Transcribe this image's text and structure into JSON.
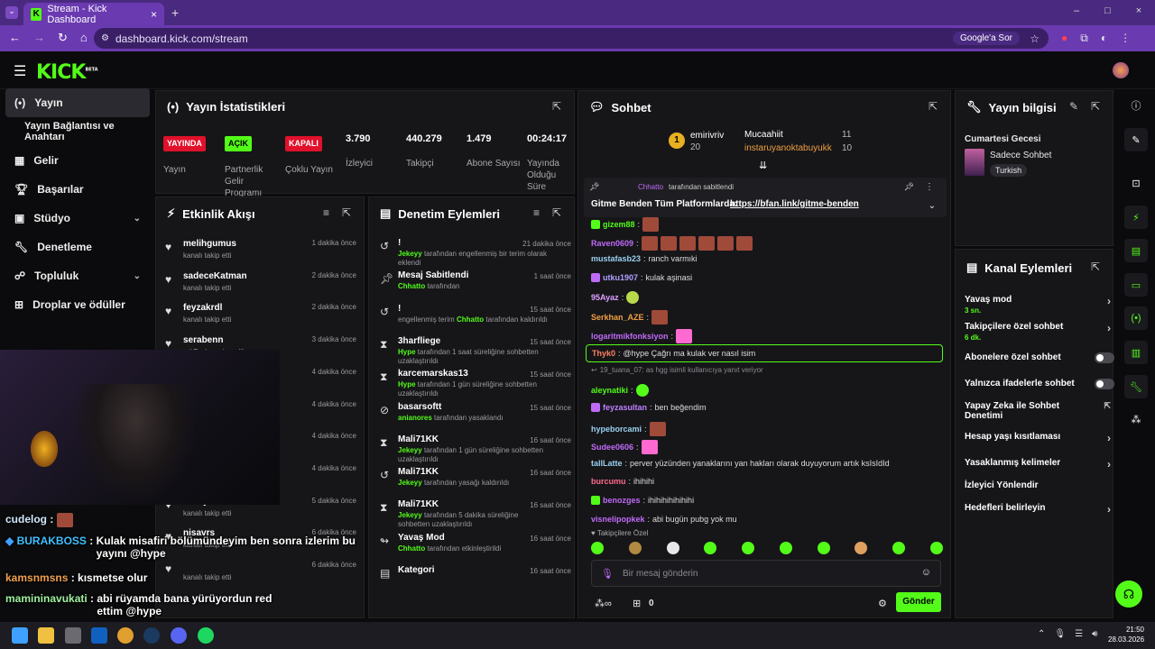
{
  "browser": {
    "tab_title": "Stream - Kick Dashboard",
    "url": "dashboard.kick.com/stream",
    "google_chip": "Google'a Sor"
  },
  "brand": {
    "logo": "KICK",
    "beta": "BETA"
  },
  "sidebar": {
    "items": [
      {
        "label": "Yayın",
        "icon": "broadcast-icon"
      },
      {
        "label": "Yayın Bağlantısı ve Anahtarı"
      },
      {
        "label": "Gelir",
        "icon": "revenue-icon"
      },
      {
        "label": "Başarılar",
        "icon": "trophy-icon"
      },
      {
        "label": "Stüdyo",
        "icon": "studio-icon"
      },
      {
        "label": "Denetleme",
        "icon": "wrench-icon"
      },
      {
        "label": "Topluluk",
        "icon": "community-icon"
      },
      {
        "label": "Droplar ve ödüller",
        "icon": "drops-icon"
      }
    ]
  },
  "stats": {
    "title": "Yayın İstatistikleri",
    "items": [
      {
        "badge": "YAYINDA",
        "label": "Yayın"
      },
      {
        "badge": "AÇIK",
        "label": "Partnerlik Gelir Programı"
      },
      {
        "badge": "KAPALI",
        "label": "Çoklu Yayın"
      },
      {
        "value": "3.790",
        "label": "İzleyici"
      },
      {
        "value": "440.279",
        "label": "Takipçi"
      },
      {
        "value": "1.479",
        "label": "Abone Sayısı"
      },
      {
        "value": "00:24:17",
        "label": "Yayında Olduğu Süre"
      }
    ]
  },
  "activity": {
    "title": "Etkinlik Akışı",
    "events": [
      {
        "name": "melihgumus",
        "desc": "kanalı takip etti",
        "time": "1 dakika önce"
      },
      {
        "name": "sadeceKatman",
        "desc": "kanalı takip etti",
        "time": "2 dakika önce"
      },
      {
        "name": "feyzakrdl",
        "desc": "kanalı takip etti",
        "time": "2 dakika önce"
      },
      {
        "name": "serabenn",
        "desc": "or! Toplam abonelik",
        "time": "3 dakika önce"
      },
      {
        "name": "",
        "desc": "",
        "time": "4 dakika önce"
      },
      {
        "name": "",
        "desc": "",
        "time": "4 dakika önce"
      },
      {
        "name": "",
        "desc": "",
        "time": "4 dakika önce"
      },
      {
        "name": "",
        "desc": "kanalı takip etti",
        "time": "4 dakika önce"
      },
      {
        "name": "Kutay3351",
        "desc": "kanalı takip etti",
        "time": "5 dakika önce"
      },
      {
        "name": "nisavrs",
        "desc": "kanalı takip etti",
        "time": "6 dakika önce"
      },
      {
        "name": "",
        "desc": "kanalı takip etti",
        "time": "6 dakika önce"
      }
    ]
  },
  "moderation": {
    "title": "Denetim Eylemleri",
    "actions": [
      {
        "title": "!",
        "user": "Jekeyy",
        "desc": "tarafından engellenmiş bir terim olarak eklendi",
        "time": "21 dakika önce"
      },
      {
        "title": "Mesaj Sabitlendi",
        "user": "Chhatto",
        "desc": "tarafından",
        "time": "1 saat önce"
      },
      {
        "title": "!",
        "user": "Chhatto",
        "prefix": "engellenmiş terim",
        "desc": "tarafından kaldırıldı",
        "time": "15 saat önce"
      },
      {
        "title": "3harfliege",
        "user": "Hype",
        "desc": "tarafından 1 saat süreliğine sohbetten uzaklaştırıldı",
        "time": "15 saat önce"
      },
      {
        "title": "karcemarskas13",
        "user": "Hype",
        "desc": "tarafından 1 gün süreliğine sohbetten uzaklaştırıldı",
        "time": "15 saat önce"
      },
      {
        "title": "basarsoftt",
        "user": "anianores",
        "desc": "tarafından yasaklandı",
        "time": "15 saat önce"
      },
      {
        "title": "Mali71KK",
        "user": "Jekeyy",
        "desc": "tarafından 1 gün süreliğine sohbetten uzaklaştırıldı",
        "time": "16 saat önce"
      },
      {
        "title": "Mali71KK",
        "user": "Jekeyy",
        "desc": "tarafından yasağı kaldırıldı",
        "time": "16 saat önce"
      },
      {
        "title": "Mali71KK",
        "user": "Jekeyy",
        "desc": "tarafından 5 dakika süreliğine sohbetten uzaklaştırıldı",
        "time": "16 saat önce"
      },
      {
        "title": "Yavaş Mod",
        "user": "Chhatto",
        "desc": "tarafından etkinleştirildi",
        "time": "16 saat önce"
      },
      {
        "title": "Kategori",
        "user": "",
        "desc": "",
        "time": "16 saat önce"
      }
    ]
  },
  "chat": {
    "title": "Sohbet",
    "leaderboard": [
      {
        "name": "emirivriv",
        "count": "20"
      },
      {
        "name": "Mucaahiit",
        "count": "11"
      },
      {
        "name": "instaruyanoktabuyukk",
        "count": "10"
      }
    ],
    "pinned": {
      "by_user": "Chhatto",
      "by_label": "tarafından sabitlendi",
      "text": "Gitme Benden Tüm Platformlarda:",
      "link": "https://bfan.link/gitme-benden"
    },
    "messages": [
      {
        "user": "gizem88",
        "text": ""
      },
      {
        "user": "Raven0609",
        "text": ""
      },
      {
        "user": "mustafasb23",
        "text": "ranch varmıki"
      },
      {
        "user": "utku1907",
        "text": "kulak aşinasi"
      },
      {
        "user": "95Ayaz",
        "text": ""
      },
      {
        "user": "Serkhan_AZE",
        "text": ""
      },
      {
        "user": "logaritmikfonksiyon",
        "text": ""
      },
      {
        "user": "Thyk0",
        "text": "@hype Çağrı ma kulak ver nasıl isim"
      },
      {
        "user": "",
        "text": "19_tuana_07: as hgg isimli kullanıcıya yanıt veriyor"
      },
      {
        "user": "aleynatiki",
        "text": ""
      },
      {
        "user": "feyzasultan",
        "text": "ben beğendim"
      },
      {
        "user": "hypeborcami",
        "text": ""
      },
      {
        "user": "Sudee0606",
        "text": ""
      },
      {
        "user": "tallLatte",
        "text": "perver yüzünden yanaklarını yan hakları olarak duyuyorum artık ksIsIdId"
      },
      {
        "user": "burcumu",
        "text": "ihihihi"
      },
      {
        "user": "benozges",
        "text": "ihihihihihihihi"
      },
      {
        "user": "visnelipopkek",
        "text": "abi bugün pubg yok mu"
      }
    ],
    "follower_only_label": "Takipçilere Özel",
    "input_placeholder": "Bir mesaj gönderin",
    "points": "0",
    "send_label": "Gönder"
  },
  "stream_info": {
    "title": "Yayın bilgisi",
    "stream_title": "Cumartesi Gecesi",
    "category": "Sadece Sohbet",
    "language": "Turkish"
  },
  "channel_actions": {
    "title": "Kanal Eylemleri",
    "items": [
      {
        "label": "Yavaş mod",
        "sub": "3 sn.",
        "control": "chevron"
      },
      {
        "label": "Takipçilere özel sohbet",
        "sub": "6 dk.",
        "control": "chevron"
      },
      {
        "label": "Abonelere özel sohbet",
        "sub": "",
        "control": "toggle"
      },
      {
        "label": "Yalnızca ifadelerle sohbet",
        "sub": "",
        "control": "toggle"
      },
      {
        "label": "Yapay Zeka ile Sohbet Denetimi",
        "sub": "",
        "control": "external"
      },
      {
        "label": "Hesap yaşı kısıtlaması",
        "sub": "",
        "control": "chevron"
      },
      {
        "label": "Yasaklanmış kelimeler",
        "sub": "",
        "control": "chevron"
      },
      {
        "label": "İzleyici Yönlendir",
        "sub": "",
        "control": "none"
      },
      {
        "label": "Hedefleri belirleyin",
        "sub": "",
        "control": "chevron"
      }
    ]
  },
  "overlay_chat": [
    {
      "user": "cudelog",
      "text": ""
    },
    {
      "user": "BURAKBOSS",
      "text": "Kulak misafiri bölümündeyim ben sonra izlerim bu yayını @hype"
    },
    {
      "user": "kamsnmsns",
      "text": "kısmetse olur"
    },
    {
      "user": "mamininavukati",
      "text": "abi rüyamda bana yürüyordun red ettim @hype"
    }
  ],
  "taskbar": {
    "time": "21:50",
    "date": "28.03.2026"
  },
  "colors": {
    "accent": "#53fc18",
    "browser": "#6a3ab0",
    "panel": "#161619",
    "live": "#e0112b"
  }
}
